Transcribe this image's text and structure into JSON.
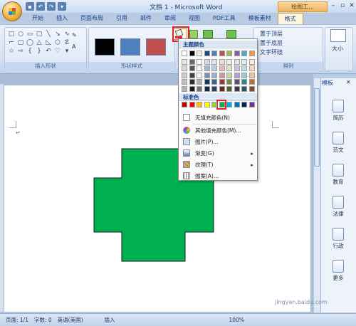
{
  "titlebar": {
    "doc_title": "文档 1 - Microsoft Word",
    "context_tab": "绘图工..."
  },
  "tabs": [
    "开始",
    "插入",
    "页面布局",
    "引用",
    "邮件",
    "审阅",
    "视图",
    "PDF工具",
    "模板素材",
    "格式"
  ],
  "ribbon": {
    "group_insert_shapes": "插入形状",
    "group_shape_styles": "形状样式",
    "group_arrange": "排列",
    "arrange_bring_front": "置于顶层",
    "arrange_send_back": "置于底层",
    "arrange_text_wrap": "文字环绕",
    "size_label": "大小",
    "style_colors": [
      "#000000",
      "#4e80c0",
      "#c0504d"
    ]
  },
  "fill_menu": {
    "theme_colors_header": "主题颜色",
    "standard_colors_header": "标准色",
    "no_fill": "无填充颜色(N)",
    "more_fill_colors": "其他填充颜色(M)...",
    "picture": "图片(P)...",
    "gradient": "渐变(G)",
    "texture": "纹理(T)",
    "pattern": "图案(A)...",
    "theme_top_row": [
      "#ffffff",
      "#000000",
      "#eeece1",
      "#1f497d",
      "#4f81bd",
      "#c0504d",
      "#9bbb59",
      "#8064a2",
      "#4bacc6",
      "#f79646"
    ],
    "standard_colors": [
      "#c00000",
      "#ff0000",
      "#ffc000",
      "#ffff00",
      "#92d050",
      "#00b050",
      "#00b0f0",
      "#0070c0",
      "#002060",
      "#7030a0"
    ],
    "selected_standard_color": "#00b050"
  },
  "document": {
    "shape_fill": "#00b050",
    "paragraph_mark": "↵"
  },
  "template_pane": {
    "title": "模板",
    "items": [
      "简历",
      "范文",
      "教育",
      "法律",
      "行政",
      "更多"
    ]
  },
  "statusbar": {
    "page": "页面: 1/1",
    "words": "字数: 0",
    "language": "英语(美国)",
    "insert_mode": "插入",
    "zoom": "100%"
  },
  "watermark": "jingyan.baidu.com"
}
